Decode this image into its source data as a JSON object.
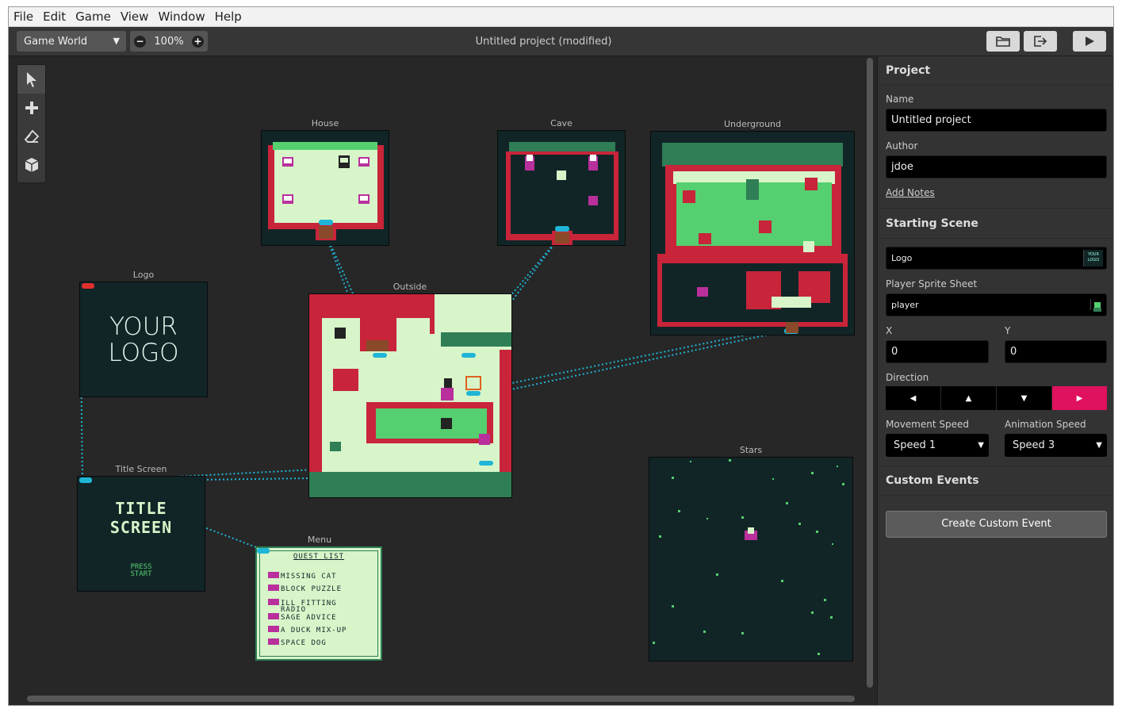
{
  "menu": [
    "File",
    "Edit",
    "Game",
    "View",
    "Window",
    "Help"
  ],
  "toolbar": {
    "scene_select": "Game World",
    "zoom_minus": "−",
    "zoom": "100%",
    "zoom_plus": "+",
    "title": "Untitled project (modified)"
  },
  "tools": [
    "select-icon",
    "add-icon",
    "eraser-icon",
    "cube-icon"
  ],
  "scenes": {
    "house": "House",
    "cave": "Cave",
    "underground": "Underground",
    "logo": "Logo",
    "outside": "Outside",
    "title_screen": "Title Screen",
    "menu": "Menu",
    "stars": "Stars"
  },
  "logo_scene": {
    "line1": "YOUR",
    "line2": "LOGO"
  },
  "title_scene": {
    "line1": "TITLE",
    "line2": "SCREEN",
    "press1": "PRESS",
    "press2": "START"
  },
  "menu_scene": {
    "header": "QUEST LIST",
    "items": [
      "MISSING CAT",
      "BLOCK PUZZLE",
      "ILL FITTING",
      "RADIO",
      "SAGE ADVICE",
      "A DUCK MIX-UP",
      "SPACE DOG"
    ]
  },
  "sidebar": {
    "project_title": "Project",
    "name_label": "Name",
    "name_value": "Untitled project",
    "author_label": "Author",
    "author_value": "jdoe",
    "add_notes": "Add Notes",
    "starting_scene_title": "Starting Scene",
    "starting_scene_value": "Logo",
    "thumb_text": "YOUR LOGO",
    "sprite_label": "Player Sprite Sheet",
    "sprite_value": "player",
    "x_label": "X",
    "y_label": "Y",
    "x_value": "0",
    "y_value": "0",
    "direction_label": "Direction",
    "directions": [
      "◀",
      "▲",
      "▼",
      "▶"
    ],
    "direction_selected": "right",
    "movement_label": "Movement Speed",
    "movement_value": "Speed 1",
    "animation_label": "Animation Speed",
    "animation_value": "Speed 3",
    "custom_events_title": "Custom Events",
    "create_event": "Create Custom Event"
  },
  "colors": {
    "accent": "#e0115f",
    "scene_bg": "#112527",
    "connection": "#1fb5d6",
    "grass_light": "#d7f5c9",
    "grass_mid": "#55cf6f",
    "wall_red": "#c8243a"
  }
}
